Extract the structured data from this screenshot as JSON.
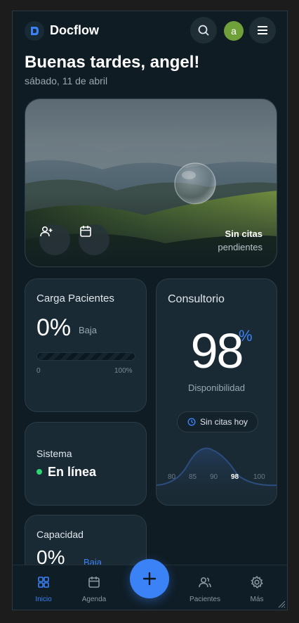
{
  "app": {
    "name": "Docflow",
    "avatar_letter": "a"
  },
  "greeting": "Buenas tardes, angel!",
  "date": "sábado, 11 de abril",
  "hero": {
    "status_line1": "Sin citas",
    "status_line2": "pendientes"
  },
  "carga": {
    "title": "Carga Pacientes",
    "value": "0%",
    "level": "Baja",
    "progress": 0,
    "min": "0",
    "max": "100%"
  },
  "sistema": {
    "title": "Sistema",
    "status": "En línea",
    "status_color": "#2ed573"
  },
  "capacidad": {
    "title": "Capacidad",
    "value": "0%",
    "level": "Baja"
  },
  "consultorio": {
    "title": "Consultorio",
    "value": "98",
    "unit": "%",
    "subtitle": "Disponibilidad",
    "badge": "Sin citas hoy",
    "axis": [
      "80",
      "85",
      "90",
      "98",
      "100"
    ],
    "axis_highlight": "98"
  },
  "nav": {
    "items": [
      {
        "label": "Inicio",
        "icon": "grid-icon",
        "active": true
      },
      {
        "label": "Agenda",
        "icon": "calendar-icon",
        "active": false
      },
      {
        "label": "Pacientes",
        "icon": "users-icon",
        "active": false
      },
      {
        "label": "Más",
        "icon": "gear-icon",
        "active": false
      }
    ],
    "fab_icon": "plus-icon"
  },
  "colors": {
    "accent": "#3b82f6",
    "background": "#0f1c24",
    "card": "#1a2a34"
  }
}
